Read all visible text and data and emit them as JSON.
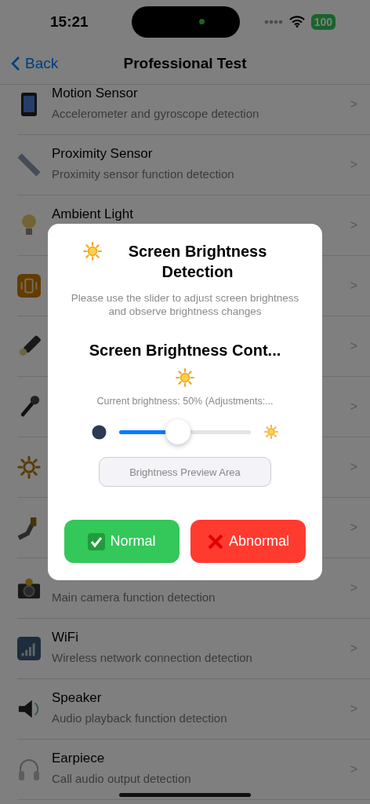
{
  "status_bar": {
    "time": "15:21",
    "battery": "100"
  },
  "nav": {
    "back": "Back",
    "title": "Professional Test"
  },
  "tests": [
    {
      "title": "Motion Sensor",
      "subtitle": "Accelerometer and gyroscope detection",
      "chevron": ">"
    },
    {
      "title": "Proximity Sensor",
      "subtitle": "Proximity sensor function detection",
      "chevron": ">"
    },
    {
      "title": "Ambient Light",
      "chevron": ">"
    },
    {
      "chevron": ">"
    },
    {
      "chevron": ">"
    },
    {
      "chevron": ">"
    },
    {
      "chevron": ">"
    },
    {
      "chevron": ">"
    },
    {
      "subtitle": "Main camera function detection",
      "chevron": ">"
    },
    {
      "title": "WiFi",
      "subtitle": "Wireless network connection detection",
      "chevron": ">"
    },
    {
      "title": "Speaker",
      "subtitle": "Audio playback function detection",
      "chevron": ">"
    },
    {
      "title": "Earpiece",
      "subtitle": "Call audio output detection",
      "chevron": ">"
    }
  ],
  "dialog": {
    "title": "Screen Brightness Detection",
    "description": "Please use the slider to adjust screen brightness and observe brightness changes",
    "section_title": "Screen Brightness Cont...",
    "reading": "Current brightness: 50% (Adjustments:...",
    "slider": {
      "level": 0.45
    },
    "preview": "Brightness Preview Area",
    "buttons": [
      {
        "kind": "pass",
        "label": "Normal"
      },
      {
        "kind": "fail",
        "label": "Abnormal"
      }
    ]
  }
}
